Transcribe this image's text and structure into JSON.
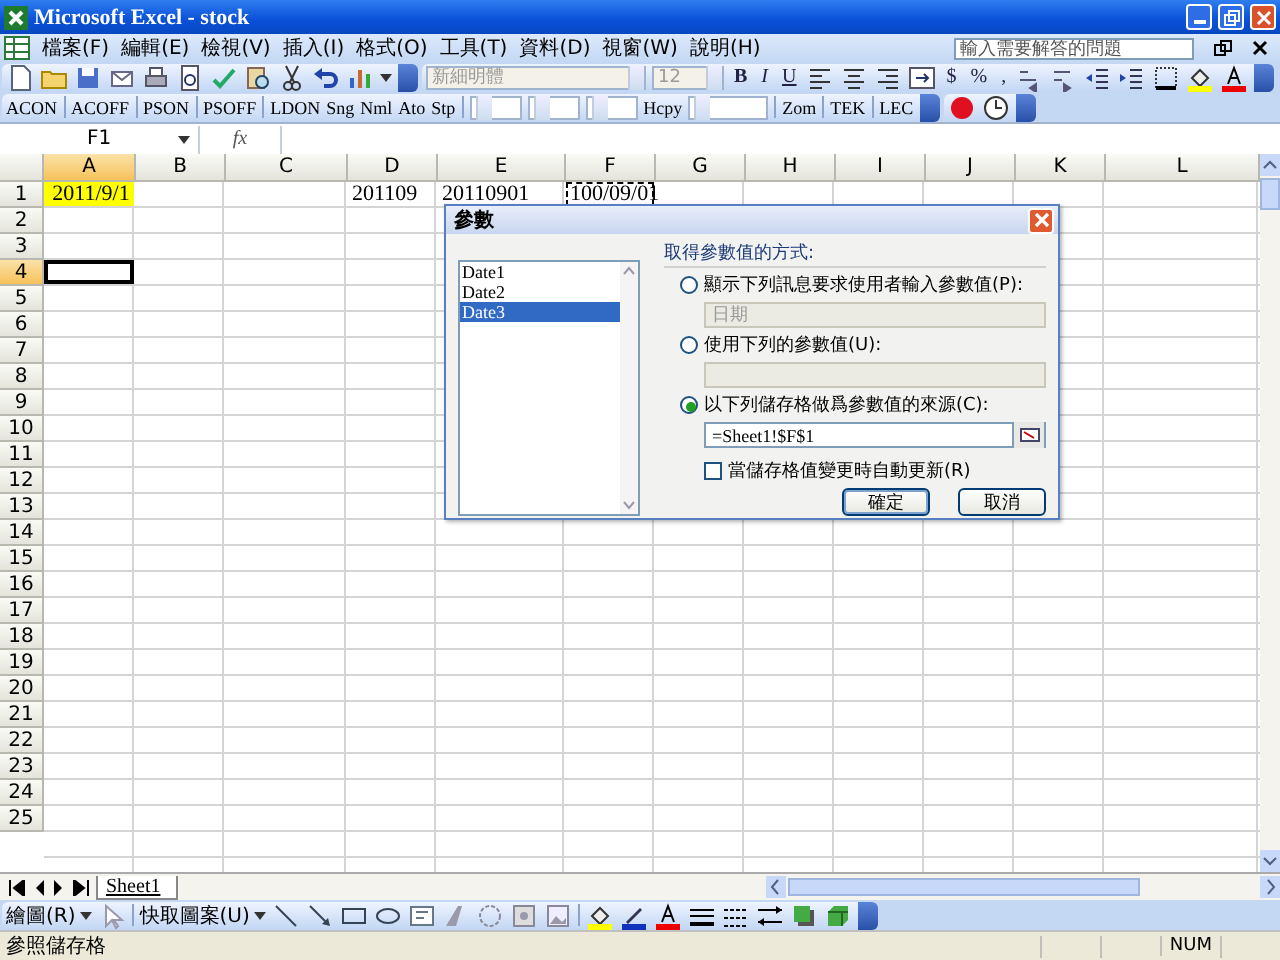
{
  "window": {
    "title": "Microsoft Excel - stock"
  },
  "menu": [
    {
      "label": "檔案(F)"
    },
    {
      "label": "編輯(E)"
    },
    {
      "label": "檢視(V)"
    },
    {
      "label": "插入(I)"
    },
    {
      "label": "格式(O)"
    },
    {
      "label": "工具(T)"
    },
    {
      "label": "資料(D)"
    },
    {
      "label": "視窗(W)"
    },
    {
      "label": "說明(H)"
    }
  ],
  "help_box": {
    "placeholder": "輸入需要解答的問題"
  },
  "formatting_toolbar": {
    "font": "新細明體",
    "size": "12",
    "style_buttons": [
      "B",
      "I",
      "U"
    ],
    "number_buttons": [
      "$",
      "%",
      ","
    ]
  },
  "custom_toolbar": {
    "buttons": [
      "ACON",
      "ACOFF",
      "PSON",
      "PSOFF",
      "LDON",
      "Sng",
      "Nml",
      "Ato",
      "Stp"
    ],
    "middle_buttons": [
      "Hcpy"
    ],
    "end_buttons": [
      "Zom",
      "TEK",
      "LEC"
    ]
  },
  "formula_bar": {
    "name_box": "F1",
    "function_label": "fx"
  },
  "sheet": {
    "columns": [
      {
        "label": "A",
        "selected": true
      },
      {
        "label": "B",
        "selected": false
      },
      {
        "label": "C",
        "selected": false
      },
      {
        "label": "D",
        "selected": false
      },
      {
        "label": "E",
        "selected": false
      },
      {
        "label": "F",
        "selected": false
      },
      {
        "label": "G",
        "selected": false
      },
      {
        "label": "H",
        "selected": false
      },
      {
        "label": "I",
        "selected": false
      },
      {
        "label": "J",
        "selected": false
      },
      {
        "label": "K",
        "selected": false
      },
      {
        "label": "L",
        "selected": false
      }
    ],
    "rows": [
      {
        "label": "1",
        "selected": false,
        "cells": {
          "A": {
            "text": "2011/9/1",
            "highlighted": true,
            "active": false,
            "copy_marquee": false
          },
          "D": {
            "text": "201109",
            "highlighted": false,
            "active": false,
            "copy_marquee": false
          },
          "E": {
            "text": "20110901",
            "highlighted": false,
            "active": false,
            "copy_marquee": false
          },
          "F": {
            "text": "100/09/01",
            "highlighted": false,
            "active": false,
            "copy_marquee": true
          }
        }
      },
      {
        "label": "2",
        "selected": false
      },
      {
        "label": "3",
        "selected": false
      },
      {
        "label": "4",
        "selected": true,
        "cells": {
          "A": {
            "highlighted": false,
            "active": true,
            "copy_marquee": false
          }
        }
      },
      {
        "label": "5",
        "selected": false
      },
      {
        "label": "6",
        "selected": false
      },
      {
        "label": "7",
        "selected": false
      },
      {
        "label": "8",
        "selected": false
      },
      {
        "label": "9",
        "selected": false
      },
      {
        "label": "10",
        "selected": false
      },
      {
        "label": "11",
        "selected": false
      },
      {
        "label": "12",
        "selected": false
      },
      {
        "label": "13",
        "selected": false
      },
      {
        "label": "14",
        "selected": false
      },
      {
        "label": "15",
        "selected": false
      },
      {
        "label": "16",
        "selected": false
      },
      {
        "label": "17",
        "selected": false
      },
      {
        "label": "18",
        "selected": false
      },
      {
        "label": "19",
        "selected": false
      },
      {
        "label": "20",
        "selected": false
      },
      {
        "label": "21",
        "selected": false
      },
      {
        "label": "22",
        "selected": false
      },
      {
        "label": "23",
        "selected": false
      },
      {
        "label": "24",
        "selected": false
      },
      {
        "label": "25",
        "selected": false
      }
    ]
  },
  "sheet_tabs": [
    {
      "label": "Sheet1",
      "selected": true
    }
  ],
  "drawing_toolbar": {
    "draw_menu": "繪圖(R)",
    "autoshapes_menu": "快取圖案(U)"
  },
  "status_bar": {
    "text": "參照儲存格",
    "num": "NUM"
  },
  "dialog": {
    "title": "參數",
    "list": [
      {
        "label": "Date1",
        "selected": false
      },
      {
        "label": "Date2",
        "selected": false
      },
      {
        "label": "Date3",
        "selected": true
      }
    ],
    "group_label": "取得參數值的方式:",
    "options": [
      {
        "label": "顯示下列訊息要求使用者輸入參數值(P):",
        "selected": false,
        "field": {
          "value": "日期",
          "disabled": true
        }
      },
      {
        "label": "使用下列的參數值(U):",
        "selected": false,
        "field": {
          "disabled": true
        }
      },
      {
        "label": "以下列儲存格做爲參數值的來源(C):",
        "selected": true,
        "field": {
          "value": "=Sheet1!$F$1",
          "disabled": false
        }
      }
    ],
    "auto_update": {
      "label": "當儲存格值變更時自動更新(R)",
      "checked": false
    },
    "buttons": [
      "確定",
      "取消"
    ]
  }
}
